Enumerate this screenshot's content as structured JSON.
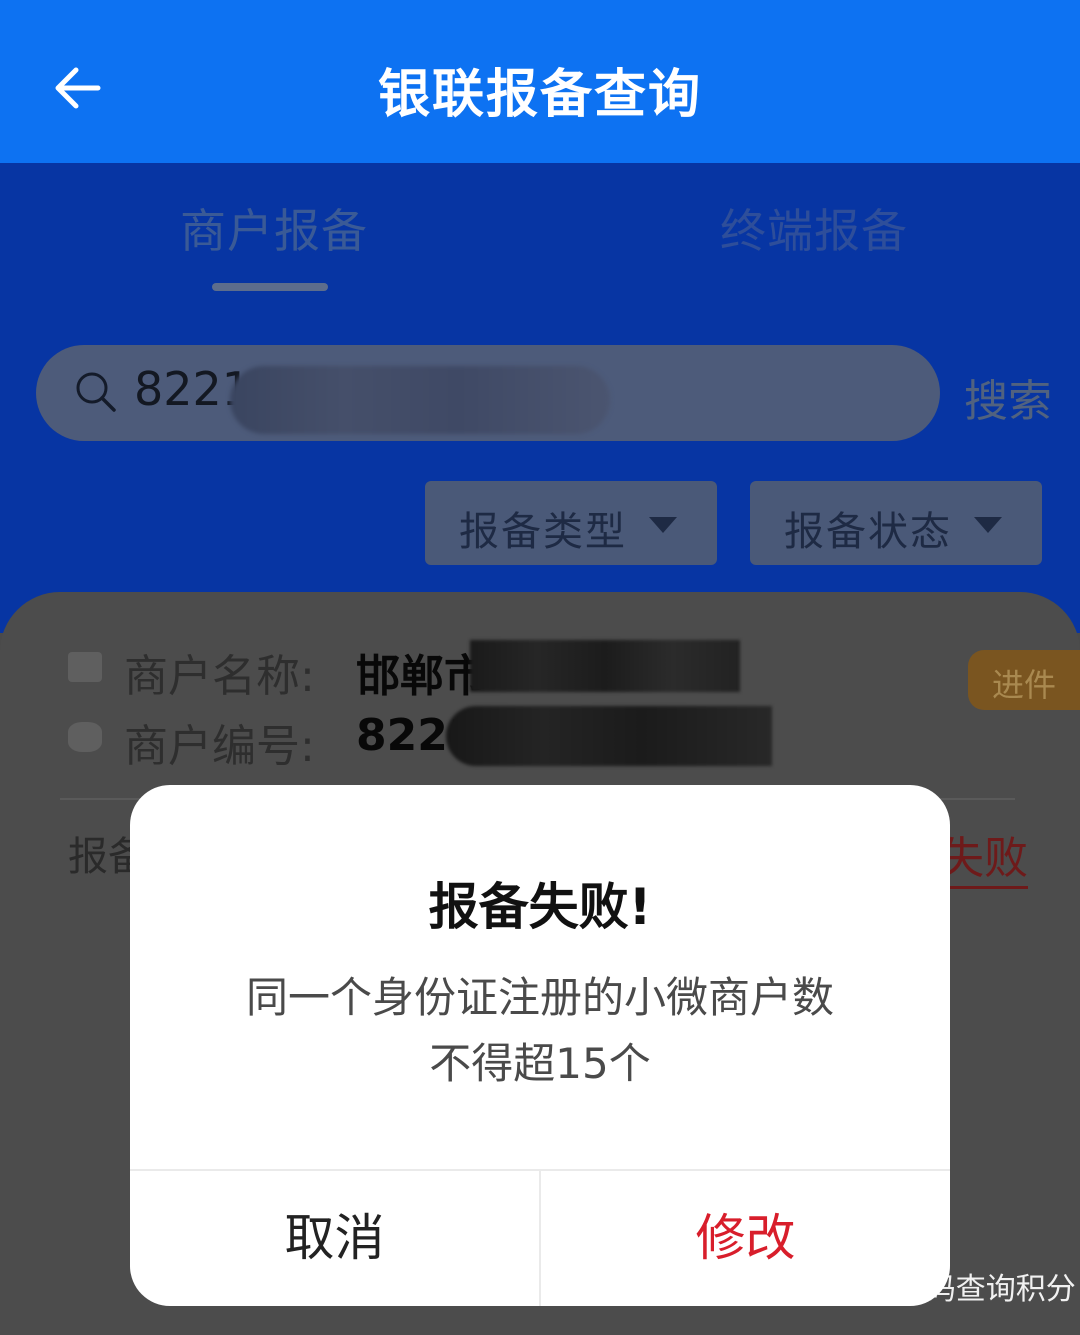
{
  "header": {
    "title": "银联报备查询"
  },
  "tabs": [
    {
      "label": "商户报备"
    },
    {
      "label": "终端报备"
    }
  ],
  "search": {
    "value": "8221",
    "button_label": "搜索"
  },
  "filters": [
    {
      "label": "报备类型"
    },
    {
      "label": "报备状态"
    }
  ],
  "card": {
    "name_label": "商户名称:",
    "name_value": "邯郸市",
    "number_label": "商户编号:",
    "number_value": "8221",
    "badge": "进件",
    "sub_label": "报备",
    "status_fragment": "失败"
  },
  "dialog": {
    "title": "报备失败!",
    "message_line1": "同一个身份证注册的小微商户数",
    "message_line2": "不得超15个",
    "cancel_label": "取消",
    "edit_label": "修改"
  },
  "watermark": {
    "text": "MCC码查询积分"
  },
  "colors": {
    "header": "#0d72f2",
    "danger": "#d81e2b",
    "badge": "#e09a2a"
  }
}
